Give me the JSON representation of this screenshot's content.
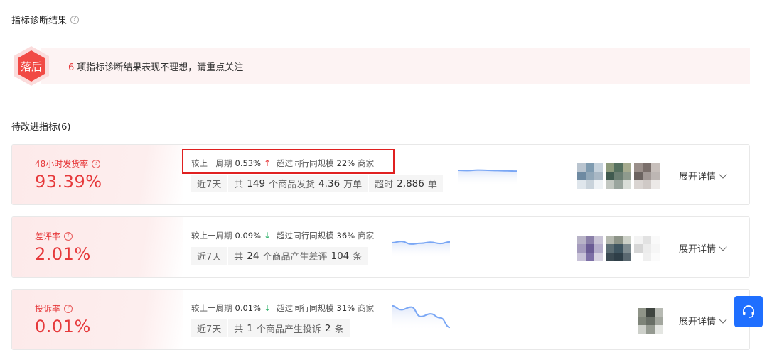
{
  "header": {
    "title": "指标诊断结果",
    "help_icon": "question-circle-icon"
  },
  "alert": {
    "badge_label": "落后",
    "count": "6",
    "message": "项指标诊断结果表现不理想，请重点关注"
  },
  "section": {
    "title": "待改进指标(6)"
  },
  "metrics": [
    {
      "name": "48小时发货率",
      "value": "93.39%",
      "cmp_label": "较上一周期",
      "cmp_value": "0.53%",
      "cmp_direction": "up",
      "beat_label": "超过同行同规模",
      "beat_value": "22%",
      "beat_unit": "商家",
      "period": "近7天",
      "stat1_pre": "共",
      "stat1_num": "149",
      "stat1_mid": "个商品发货",
      "stat1_num2": "4.36",
      "stat1_unit": "万单",
      "stat2_pre": "超时",
      "stat2_num": "2,886",
      "stat2_unit": "单",
      "expand_label": "展开详情",
      "trend": [
        0.5,
        0.49,
        0.51,
        0.5,
        0.49,
        0.48,
        0.47
      ]
    },
    {
      "name": "差评率",
      "value": "2.01%",
      "cmp_label": "较上一周期",
      "cmp_value": "0.09%",
      "cmp_direction": "down",
      "beat_label": "超过同行同规模",
      "beat_value": "36%",
      "beat_unit": "商家",
      "period": "近7天",
      "stat1_pre": "共",
      "stat1_num": "24",
      "stat1_mid": "个商品产生差评",
      "stat1_num2": "104",
      "stat1_unit": "条",
      "expand_label": "展开详情",
      "trend": [
        0.5,
        0.55,
        0.45,
        0.48,
        0.52,
        0.47,
        0.53
      ]
    },
    {
      "name": "投诉率",
      "value": "0.01%",
      "cmp_label": "较上一周期",
      "cmp_value": "0.01%",
      "cmp_direction": "down",
      "beat_label": "超过同行同规模",
      "beat_value": "31%",
      "beat_unit": "商家",
      "period": "近7天",
      "stat1_pre": "共",
      "stat1_num": "1",
      "stat1_mid": "个商品产生投诉",
      "stat1_num2": "2",
      "stat1_unit": "条",
      "expand_label": "展开详情",
      "trend": [
        0.85,
        0.7,
        0.8,
        0.45,
        0.55,
        0.4,
        0.05
      ]
    }
  ],
  "colors": {
    "danger": "#e6393b",
    "success": "#2fb16a",
    "accent": "#1f6fff",
    "trend_line": "#7aa7f5"
  },
  "support_icon": "headset-icon"
}
